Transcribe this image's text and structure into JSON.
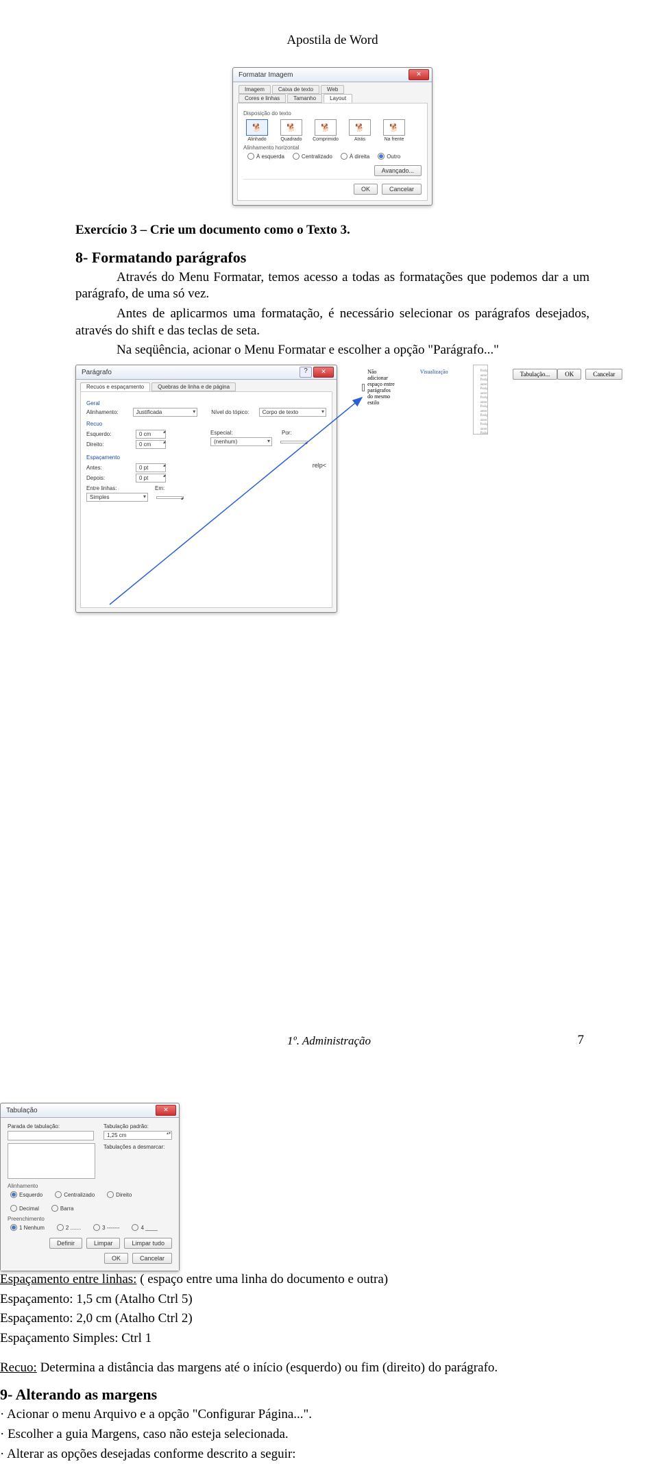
{
  "header": {
    "title": "Apostila de Word"
  },
  "dlg1": {
    "title": "Formatar Imagem",
    "tabs": [
      "Imagem",
      "Caixa de texto",
      "Web",
      "Cores e linhas",
      "Tamanho",
      "Layout"
    ],
    "active_tab": "Layout",
    "section_wrap": "Disposição do texto",
    "wrap_options": [
      "Alinhado",
      "Quadrado",
      "Comprimido",
      "Atrás",
      "Na frente"
    ],
    "section_halign": "Alinhamento horizontal",
    "halign_options": [
      "À esquerda",
      "Centralizado",
      "À direita",
      "Outro"
    ],
    "halign_selected": "Outro",
    "btn_advanced": "Avançado...",
    "btn_ok": "OK",
    "btn_cancel": "Cancelar"
  },
  "text": {
    "ex3": "Exercício 3 – Crie um documento como o Texto 3.",
    "h8": "8- Formatando parágrafos",
    "p1a": "Através do Menu Formatar, temos acesso a todas as formatações que podemos dar a um parágrafo, de uma só vez.",
    "p1b": "Antes de aplicarmos uma formatação, é necessário selecionar os parágrafos desejados, através do shift e das teclas de seta.",
    "p1c": "Na seqüência, acionar o Menu Formatar e escolher a opção \"Parágrafo...\"",
    "spacing_u": "Espaçamento entre linhas:",
    "spacing_rest": " ( espaço entre uma linha do documento e outra)",
    "spacing_15": "Espaçamento: 1,5 cm (Atalho Ctrl 5)",
    "spacing_20": "Espaçamento: 2,0 cm (Atalho Ctrl 2)",
    "spacing_s": "Espaçamento Simples: Ctrl 1",
    "recuo_u": "Recuo:",
    "recuo_rest": " Determina a distância das margens até o início (esquerdo) ou fim (direito) do parágrafo.",
    "h9": "9- Alterando as margens",
    "li1": "· Acionar o menu Arquivo e a opção \"Configurar Página...\".",
    "li2": "· Escolher a guia Margens, caso não esteja selecionada.",
    "li3": "· Alterar as opções desejadas conforme descrito a seguir:"
  },
  "dlg2": {
    "title": "Parágrafo",
    "tabs": [
      "Recuos e espaçamento",
      "Quebras de linha e de página"
    ],
    "active_tab": "Recuos e espaçamento",
    "section_geral": "Geral",
    "lbl_align": "Alinhamento:",
    "val_align": "Justificada",
    "lbl_nivel": "Nível do tópico:",
    "val_nivel": "Corpo de texto",
    "section_recuo": "Recuo",
    "lbl_esq": "Esquerdo:",
    "val_esq": "0 cm",
    "lbl_dir": "Direito:",
    "val_dir": "0 cm",
    "lbl_especial": "Especial:",
    "val_especial": "(nenhum)",
    "lbl_por": "Por:",
    "section_esp": "Espaçamento",
    "lbl_antes": "Antes:",
    "val_antes": "0 pt",
    "lbl_depois": "Depois:",
    "val_depois": "0 pt",
    "lbl_entre": "Entre linhas:",
    "val_entre": "Simples",
    "lbl_em": "Em:",
    "chk_dont": "Não adicionar espaço entre parágrafos do mesmo estilo",
    "section_viz": "Visualização",
    "btn_tabs": "Tabulação...",
    "btn_ok": "OK",
    "btn_cancel": "Cancelar"
  },
  "dlg3": {
    "title": "Tabulação",
    "lbl_stop": "Parada de tabulação:",
    "lbl_default": "Tabulação padrão:",
    "val_default": "1,25 cm",
    "lbl_clear": "Tabulações a desmarcar:",
    "section_align": "Alinhamento",
    "align_options": [
      "Esquerdo",
      "Centralizado",
      "Direito",
      "Decimal",
      "Barra"
    ],
    "align_selected": "Esquerdo",
    "section_fill": "Preenchimento",
    "fill_options": [
      "1 Nenhum",
      "2 .......",
      "3 -------",
      "4 ____"
    ],
    "fill_selected": "1 Nenhum",
    "btn_set": "Definir",
    "btn_clear": "Limpar",
    "btn_clearall": "Limpar tudo",
    "btn_ok": "OK",
    "btn_cancel": "Cancelar"
  },
  "footer": {
    "center": "1º. Administração",
    "page": "7"
  }
}
